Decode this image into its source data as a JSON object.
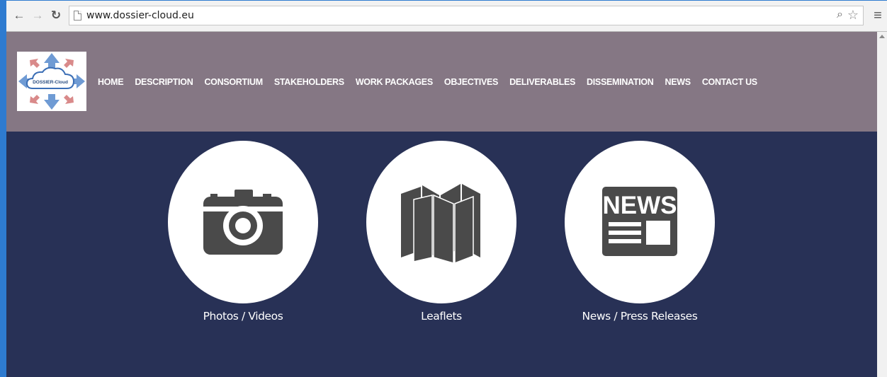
{
  "browser": {
    "back_icon": "arrow-left-icon",
    "forward_icon": "arrow-right-icon",
    "reload_icon": "reload-icon",
    "url": "www.dossier-cloud.eu",
    "accent_color": "#2e7bd0"
  },
  "header": {
    "background": "#857784",
    "logo": {
      "text": "DOSSIER-Cloud"
    },
    "nav": [
      "HOME",
      "DESCRIPTION",
      "CONSORTIUM",
      "STAKEHOLDERS",
      "WORK PACKAGES",
      "OBJECTIVES",
      "DELIVERABLES",
      "DISSEMINATION",
      "NEWS",
      "CONTACT US"
    ]
  },
  "content": {
    "background": "#283156",
    "tiles": [
      {
        "caption": "Photos / Videos",
        "icon": "camera-icon"
      },
      {
        "caption": "Leaflets",
        "icon": "map-leaflet-icon"
      },
      {
        "caption": "News / Press Releases",
        "icon": "newspaper-icon",
        "icon_text": "NEWS"
      }
    ]
  }
}
